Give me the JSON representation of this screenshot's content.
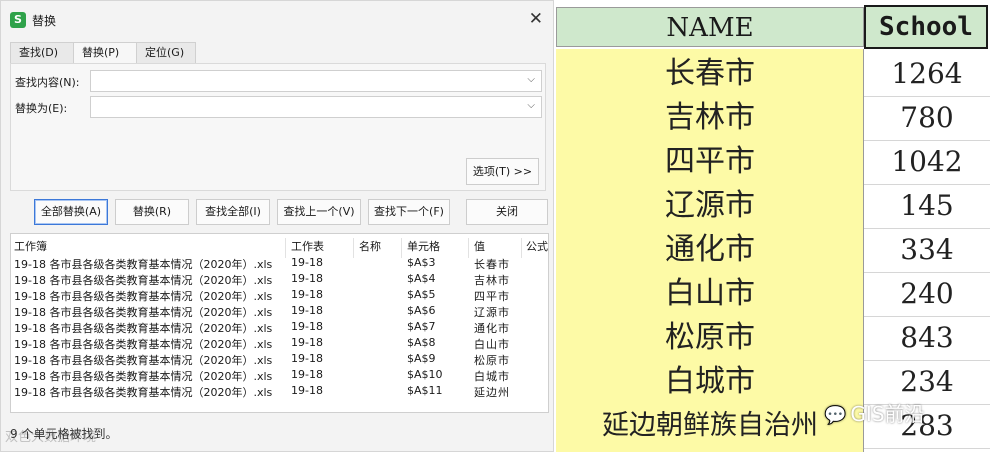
{
  "dialog": {
    "title": "替换",
    "app_icon_letter": "S",
    "close_glyph": "✕",
    "tabs": [
      {
        "label": "查找(D)",
        "active": false
      },
      {
        "label": "替换(P)",
        "active": true
      },
      {
        "label": "定位(G)",
        "active": false
      }
    ],
    "find_label": "查找内容(N):",
    "find_value": "",
    "replace_label": "替换为(E):",
    "replace_value": "",
    "dropdown_glyph": "⌵",
    "options_button": "选项(T) >>",
    "buttons": {
      "replace_all": "全部替换(A)",
      "replace": "替换(R)",
      "find_all": "查找全部(I)",
      "find_prev": "查找上一个(V)",
      "find_next": "查找下一个(F)",
      "close": "关闭"
    },
    "results": {
      "columns": [
        "工作簿",
        "工作表",
        "名称",
        "单元格",
        "值",
        "公式"
      ],
      "rows": [
        {
          "workbook": "19-18 各市县各级各类教育基本情况（2020年）.xls",
          "sheet": "19-18",
          "name": "",
          "cell": "$A$3",
          "value": "长春市"
        },
        {
          "workbook": "19-18 各市县各级各类教育基本情况（2020年）.xls",
          "sheet": "19-18",
          "name": "",
          "cell": "$A$4",
          "value": "吉林市"
        },
        {
          "workbook": "19-18 各市县各级各类教育基本情况（2020年）.xls",
          "sheet": "19-18",
          "name": "",
          "cell": "$A$5",
          "value": "四平市"
        },
        {
          "workbook": "19-18 各市县各级各类教育基本情况（2020年）.xls",
          "sheet": "19-18",
          "name": "",
          "cell": "$A$6",
          "value": "辽源市"
        },
        {
          "workbook": "19-18 各市县各级各类教育基本情况（2020年）.xls",
          "sheet": "19-18",
          "name": "",
          "cell": "$A$7",
          "value": "通化市"
        },
        {
          "workbook": "19-18 各市县各级各类教育基本情况（2020年）.xls",
          "sheet": "19-18",
          "name": "",
          "cell": "$A$8",
          "value": "白山市"
        },
        {
          "workbook": "19-18 各市县各级各类教育基本情况（2020年）.xls",
          "sheet": "19-18",
          "name": "",
          "cell": "$A$9",
          "value": "松原市"
        },
        {
          "workbook": "19-18 各市县各级各类教育基本情况（2020年）.xls",
          "sheet": "19-18",
          "name": "",
          "cell": "$A$10",
          "value": "白城市"
        },
        {
          "workbook": "19-18 各市县各级各类教育基本情况（2020年）.xls",
          "sheet": "19-18",
          "name": "",
          "cell": "$A$11",
          "value": "延边州"
        }
      ]
    },
    "status": "9 个单元格被找到。",
    "watermark": "双色大数据环境"
  },
  "sheet": {
    "headers": {
      "name": "NAME",
      "school": "School"
    },
    "rows": [
      {
        "name": "长春市",
        "school": "1264"
      },
      {
        "name": "吉林市",
        "school": "780"
      },
      {
        "name": "四平市",
        "school": "1042"
      },
      {
        "name": "辽源市",
        "school": "145"
      },
      {
        "name": "通化市",
        "school": "334"
      },
      {
        "name": "白山市",
        "school": "240"
      },
      {
        "name": "松原市",
        "school": "843"
      },
      {
        "name": "白城市",
        "school": "234"
      },
      {
        "name": "延边朝鲜族自治州",
        "school": "283"
      }
    ],
    "colors": {
      "header_bg": "#cfe8cc",
      "name_bg": "#fdfaa6"
    }
  },
  "watermark_brand": {
    "bubble": "💬",
    "text": "GIS前沿"
  }
}
